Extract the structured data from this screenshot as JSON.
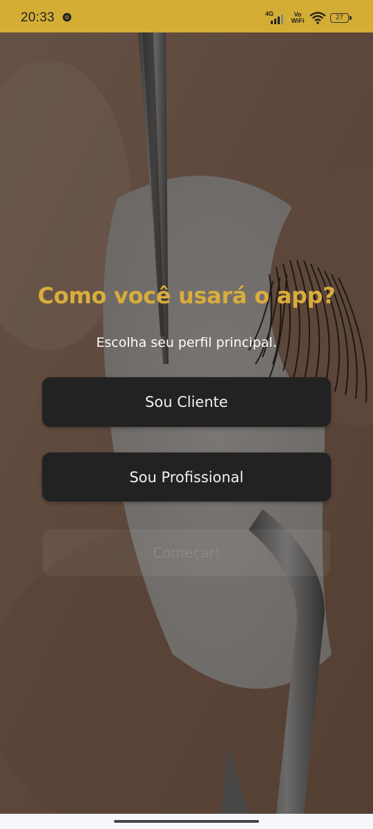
{
  "status_bar": {
    "time": "20:33",
    "network_type": "4G",
    "vowifi_line1": "Vo",
    "vowifi_line2": "WiFi",
    "battery_level": "27",
    "bar_color": "#d4ad35",
    "app_icon": "chrome-icon"
  },
  "main": {
    "title": "Como você usará o app?",
    "subtitle": "Escolha seu perfil principal.",
    "title_color": "#d9ad3c"
  },
  "options": {
    "client_label": "Sou Cliente",
    "professional_label": "Sou Profissional"
  },
  "actions": {
    "start_label": "Começar!",
    "start_enabled": false
  },
  "icons": {
    "signal": "signal-bars-icon",
    "wifi": "wifi-icon",
    "battery": "battery-icon"
  }
}
